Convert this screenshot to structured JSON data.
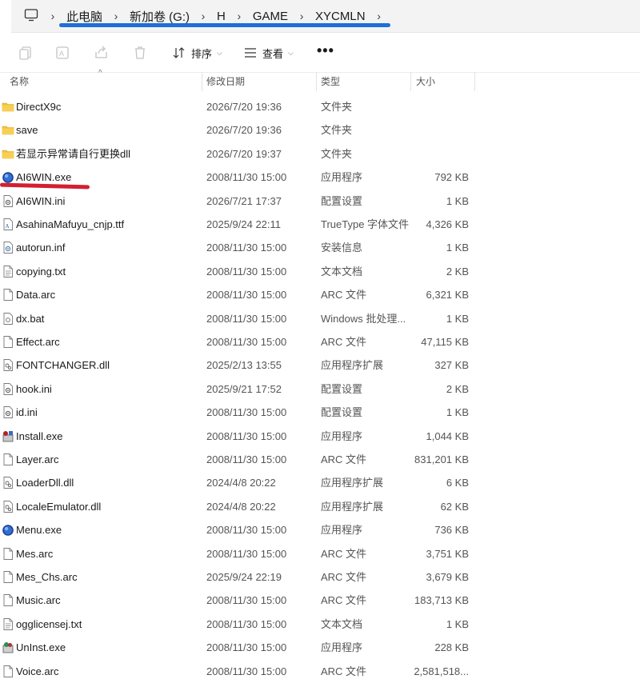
{
  "breadcrumb": [
    "此电脑",
    "新加卷 (G:)",
    "H",
    "GAME",
    "XYCMLN"
  ],
  "toolbar": {
    "sort_label": "排序",
    "view_label": "查看",
    "more_label": "•••"
  },
  "columns": {
    "name": "名称",
    "date": "修改日期",
    "type": "类型",
    "size": "大小"
  },
  "files": [
    {
      "name": "DirectX9c",
      "date": "2026/7/20 19:36",
      "type": "文件夹",
      "size": "",
      "icon": "folder-icon"
    },
    {
      "name": "save",
      "date": "2026/7/20 19:36",
      "type": "文件夹",
      "size": "",
      "icon": "folder-icon"
    },
    {
      "name": "若显示异常请自行更换dll",
      "date": "2026/7/20 19:37",
      "type": "文件夹",
      "size": "",
      "icon": "folder-icon"
    },
    {
      "name": "AI6WIN.exe",
      "date": "2008/11/30 15:00",
      "type": "应用程序",
      "size": "792 KB",
      "icon": "blue-globe-app-icon"
    },
    {
      "name": "AI6WIN.ini",
      "date": "2026/7/21 17:37",
      "type": "配置设置",
      "size": "1 KB",
      "icon": "settings-file-icon"
    },
    {
      "name": "AsahinaMafuyu_cnjp.ttf",
      "date": "2025/9/24 22:11",
      "type": "TrueType 字体文件",
      "size": "4,326 KB",
      "icon": "font-file-icon"
    },
    {
      "name": "autorun.inf",
      "date": "2008/11/30 15:00",
      "type": "安装信息",
      "size": "1 KB",
      "icon": "setup-info-icon"
    },
    {
      "name": "copying.txt",
      "date": "2008/11/30 15:00",
      "type": "文本文档",
      "size": "2 KB",
      "icon": "text-file-icon"
    },
    {
      "name": "Data.arc",
      "date": "2008/11/30 15:00",
      "type": "ARC 文件",
      "size": "6,321 KB",
      "icon": "blank-file-icon"
    },
    {
      "name": "dx.bat",
      "date": "2008/11/30 15:00",
      "type": "Windows 批处理...",
      "size": "1 KB",
      "icon": "batch-file-icon"
    },
    {
      "name": "Effect.arc",
      "date": "2008/11/30 15:00",
      "type": "ARC 文件",
      "size": "47,115 KB",
      "icon": "blank-file-icon"
    },
    {
      "name": "FONTCHANGER.dll",
      "date": "2025/2/13 13:55",
      "type": "应用程序扩展",
      "size": "327 KB",
      "icon": "dll-file-icon"
    },
    {
      "name": "hook.ini",
      "date": "2025/9/21 17:52",
      "type": "配置设置",
      "size": "2 KB",
      "icon": "settings-file-icon"
    },
    {
      "name": "id.ini",
      "date": "2008/11/30 15:00",
      "type": "配置设置",
      "size": "1 KB",
      "icon": "settings-file-icon"
    },
    {
      "name": "Install.exe",
      "date": "2008/11/30 15:00",
      "type": "应用程序",
      "size": "1,044 KB",
      "icon": "installer-icon"
    },
    {
      "name": "Layer.arc",
      "date": "2008/11/30 15:00",
      "type": "ARC 文件",
      "size": "831,201 KB",
      "icon": "blank-file-icon"
    },
    {
      "name": "LoaderDll.dll",
      "date": "2024/4/8 20:22",
      "type": "应用程序扩展",
      "size": "6 KB",
      "icon": "dll-file-icon"
    },
    {
      "name": "LocaleEmulator.dll",
      "date": "2024/4/8 20:22",
      "type": "应用程序扩展",
      "size": "62 KB",
      "icon": "dll-file-icon"
    },
    {
      "name": "Menu.exe",
      "date": "2008/11/30 15:00",
      "type": "应用程序",
      "size": "736 KB",
      "icon": "blue-globe-app-icon"
    },
    {
      "name": "Mes.arc",
      "date": "2008/11/30 15:00",
      "type": "ARC 文件",
      "size": "3,751 KB",
      "icon": "blank-file-icon"
    },
    {
      "name": "Mes_Chs.arc",
      "date": "2025/9/24 22:19",
      "type": "ARC 文件",
      "size": "3,679 KB",
      "icon": "blank-file-icon"
    },
    {
      "name": "Music.arc",
      "date": "2008/11/30 15:00",
      "type": "ARC 文件",
      "size": "183,713 KB",
      "icon": "blank-file-icon"
    },
    {
      "name": "ogglicensej.txt",
      "date": "2008/11/30 15:00",
      "type": "文本文档",
      "size": "1 KB",
      "icon": "text-file-icon"
    },
    {
      "name": "UnInst.exe",
      "date": "2008/11/30 15:00",
      "type": "应用程序",
      "size": "228 KB",
      "icon": "uninstaller-icon"
    },
    {
      "name": "Voice.arc",
      "date": "2008/11/30 15:00",
      "type": "ARC 文件",
      "size": "2,581,518...",
      "icon": "blank-file-icon"
    }
  ],
  "colors": {
    "breadcrumb_annotation": "#1e6fd9",
    "file_annotation": "#d2202f",
    "folder": "#f3c13a"
  }
}
